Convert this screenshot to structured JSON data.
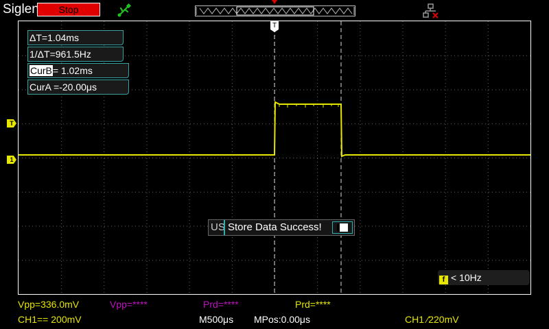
{
  "header": {
    "brand": "Siglent",
    "run_state": "Stop",
    "usb_icon": "usb-connected-icon",
    "network_icon": "network-disconnected-icon"
  },
  "measurements": {
    "delta_t": "ΔT=1.04ms",
    "inv_delta_t": "1/ΔT=961.5Hz",
    "cur_b_key": "CurB",
    "cur_b_value": "= 1.02ms",
    "cur_a": "CurA =-20.00μs"
  },
  "markers": {
    "trigger_position": "T",
    "trigger_level": "T",
    "ch1": "1"
  },
  "toast": {
    "prefix": "US",
    "message": "Store Data Success!"
  },
  "trigger_freq": {
    "icon": "f",
    "text": "< 10Hz"
  },
  "status": {
    "row1": {
      "ch1_vpp": "Vpp=336.0mV",
      "ch2_vpp": "Vpp=****",
      "ch2_prd": "Prd=****",
      "ch1_prd": "Prd=****"
    },
    "row2": {
      "ch1_scale": "CH1== 200mV",
      "timebase": "M500μs",
      "position": "MPos:0.00μs",
      "trigger": "CH1 ∕220mV"
    }
  },
  "colors": {
    "ch1": "#e6e600",
    "ch2": "#c010c0",
    "stop": "#e00000",
    "usb": "#20c020",
    "accent": "#2fb0b0"
  }
}
